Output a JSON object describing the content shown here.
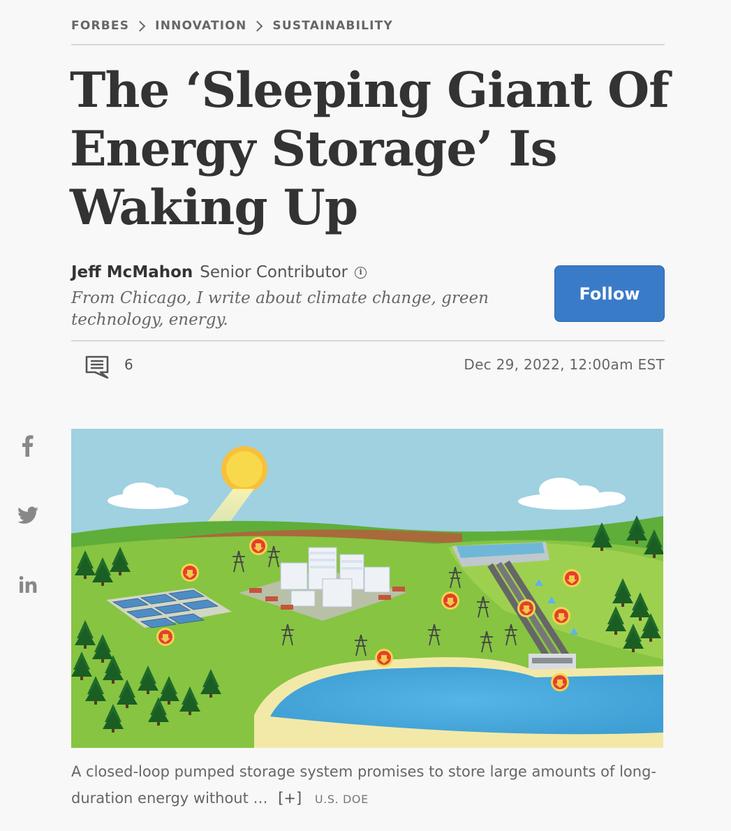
{
  "breadcrumb": {
    "items": [
      "FORBES",
      "INNOVATION",
      "SUSTAINABILITY"
    ]
  },
  "headline": "The ‘Sleeping Giant Of Energy Storage’ Is Waking Up",
  "author": {
    "name": "Jeff McMahon",
    "role": "Senior Contributor",
    "bio": "From Chicago, I write about climate change, green technology, energy."
  },
  "follow_label": "Follow",
  "comments": {
    "count": "6"
  },
  "dateline": "Dec 29, 2022, 12:00am EST",
  "share": {
    "icons": [
      "facebook-icon",
      "twitter-icon",
      "linkedin-icon"
    ]
  },
  "image": {
    "caption": "A closed-loop pumped storage system promises to store large amounts of long-duration energy without …",
    "expand_label": "[+]",
    "credit": "U.S. DOE"
  },
  "colors": {
    "accent": "#3a7bc8",
    "text": "#333333",
    "muted": "#666666",
    "background": "#f8f8f8"
  }
}
